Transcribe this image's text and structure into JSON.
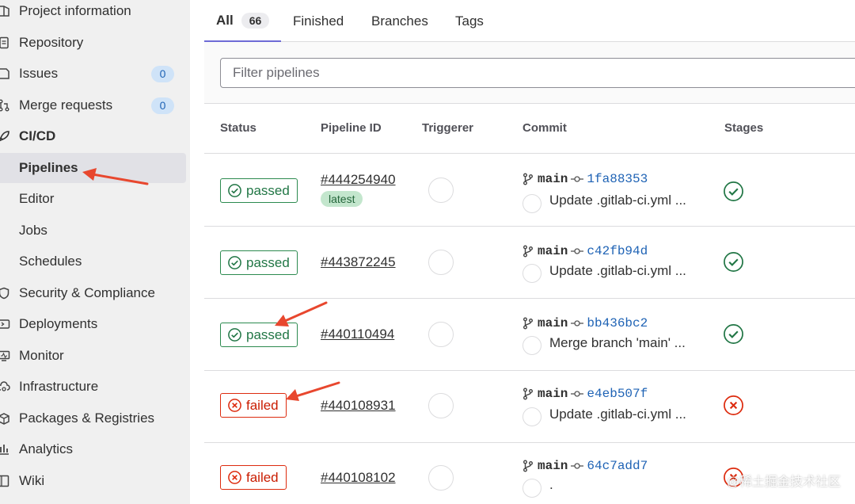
{
  "sidebar": {
    "items": [
      {
        "label": "Project information",
        "icon": "project-icon"
      },
      {
        "label": "Repository",
        "icon": "document-icon"
      },
      {
        "label": "Issues",
        "icon": "issues-icon",
        "badge": "0"
      },
      {
        "label": "Merge requests",
        "icon": "merge-request-icon",
        "badge": "0"
      },
      {
        "label": "CI/CD",
        "icon": "rocket-icon"
      },
      {
        "label": "Pipelines"
      },
      {
        "label": "Editor"
      },
      {
        "label": "Jobs"
      },
      {
        "label": "Schedules"
      },
      {
        "label": "Security & Compliance",
        "icon": "shield-icon"
      },
      {
        "label": "Deployments",
        "icon": "deployments-icon"
      },
      {
        "label": "Monitor",
        "icon": "monitor-icon"
      },
      {
        "label": "Infrastructure",
        "icon": "cloud-gear-icon"
      },
      {
        "label": "Packages & Registries",
        "icon": "package-icon"
      },
      {
        "label": "Analytics",
        "icon": "chart-icon"
      },
      {
        "label": "Wiki",
        "icon": "book-icon"
      }
    ]
  },
  "tabs": [
    {
      "label": "All",
      "count": "66"
    },
    {
      "label": "Finished"
    },
    {
      "label": "Branches"
    },
    {
      "label": "Tags"
    }
  ],
  "filter": {
    "placeholder": "Filter pipelines"
  },
  "table": {
    "headers": [
      "Status",
      "Pipeline ID",
      "Triggerer",
      "Commit",
      "Stages"
    ],
    "rows": [
      {
        "status": "passed",
        "id": "#444254940",
        "latest": "latest",
        "branch": "main",
        "sha": "1fa88353",
        "title": "Update .gitlab-ci.yml ..."
      },
      {
        "status": "passed",
        "id": "#443872245",
        "branch": "main",
        "sha": "c42fb94d",
        "title": "Update .gitlab-ci.yml ..."
      },
      {
        "status": "passed",
        "id": "#440110494",
        "branch": "main",
        "sha": "bb436bc2",
        "title": "Merge branch 'main' ..."
      },
      {
        "status": "failed",
        "id": "#440108931",
        "branch": "main",
        "sha": "e4eb507f",
        "title": "Update .gitlab-ci.yml ..."
      },
      {
        "status": "failed",
        "id": "#440108102",
        "branch": "main",
        "sha": "64c7add7",
        "title": "."
      }
    ]
  },
  "colors": {
    "passed": "#217645",
    "failed": "#dd2b0e",
    "link": "#1f63b5",
    "annotation_arrow": "#e8472e"
  },
  "watermark": "@稀土掘金技术社区"
}
